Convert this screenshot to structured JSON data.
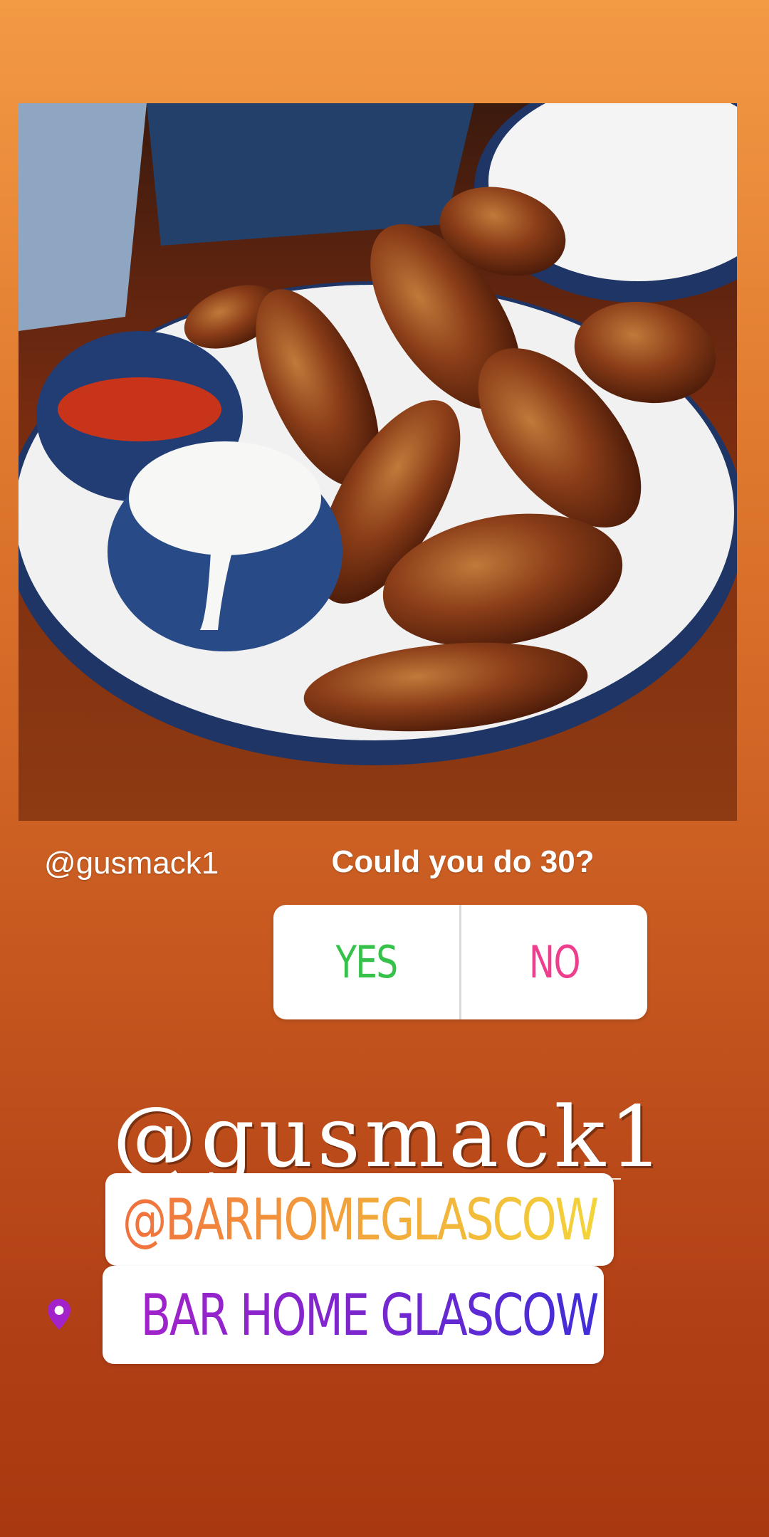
{
  "story": {
    "photo_credit": "@gusmack1",
    "poll": {
      "question": "Could you do 30?",
      "options": [
        "YES",
        "NO"
      ],
      "colors": {
        "yes": "#36c24a",
        "no": "#ee3f8f"
      }
    },
    "mention_large": "@gusmack1",
    "mention_sticker": "@BARHOMEGLASCOW",
    "location_sticker": {
      "icon": "location-pin-icon",
      "label": "BAR HOME GLASCOW"
    }
  },
  "colors": {
    "background_top": "#f39a45",
    "background_bottom": "#a8380f",
    "handle_gradient": [
      "#f0703e",
      "#f3d43a"
    ],
    "location_gradient": [
      "#a123c9",
      "#3f2ed8"
    ]
  }
}
